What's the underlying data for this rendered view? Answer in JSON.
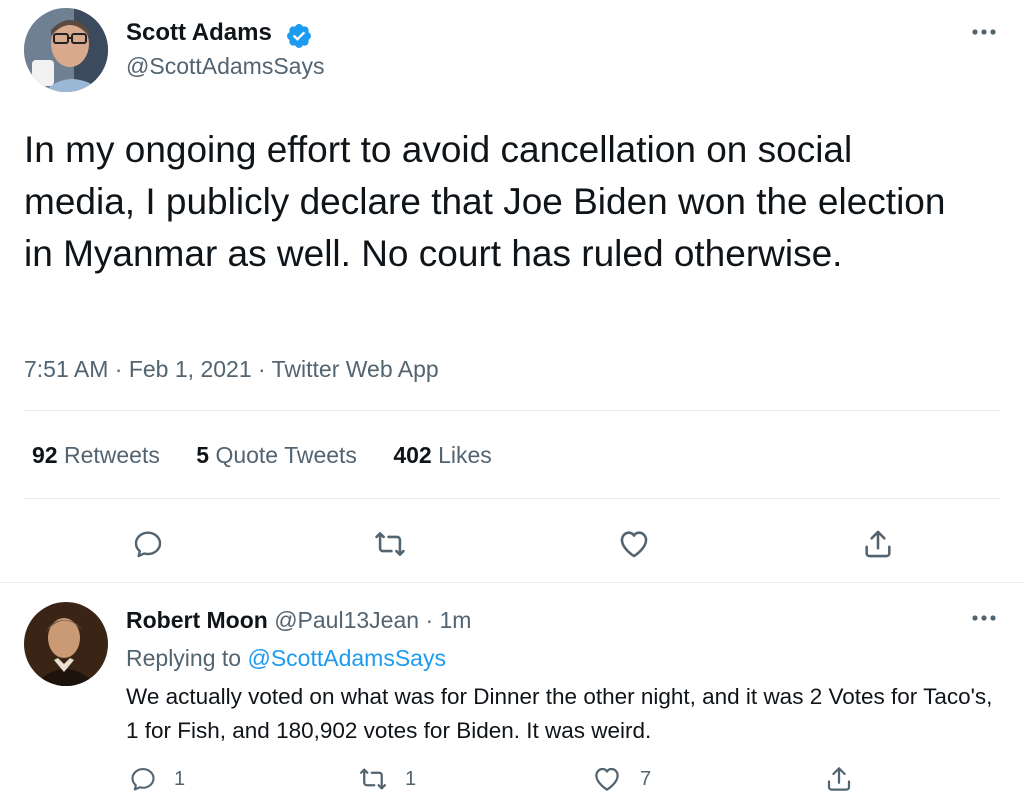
{
  "tweet": {
    "author_name": "Scott Adams",
    "author_handle": "@ScottAdamsSays",
    "text": "In my ongoing effort to avoid cancellation on social media, I publicly declare that Joe Biden won the election in Myanmar as well. No court has ruled otherwise.",
    "time": "7:51 AM",
    "date": "Feb 1, 2021",
    "source": "Twitter Web App",
    "stats": {
      "retweets_count": "92",
      "retweets_label": "Retweets",
      "quotes_count": "5",
      "quotes_label": "Quote Tweets",
      "likes_count": "402",
      "likes_label": "Likes"
    },
    "icons": [
      "reply-icon",
      "retweet-icon",
      "like-icon",
      "share-icon",
      "more-icon",
      "verified-icon"
    ]
  },
  "reply": {
    "author_name": "Robert Moon",
    "author_handle": "@Paul13Jean",
    "age": "1m",
    "replying_to_label": "Replying to",
    "replying_to_handle": "@ScottAdamsSays",
    "text": "We actually voted on what was for Dinner the other night, and it was 2 Votes for Taco's, 1 for Fish, and 180,902 votes for Biden. It was weird.",
    "reply_count": "1",
    "retweet_count": "1",
    "like_count": "7"
  },
  "colors": {
    "accent": "#1d9bf0",
    "text": "#0f1419",
    "muted": "#536471",
    "divider": "#e6ecf0"
  }
}
